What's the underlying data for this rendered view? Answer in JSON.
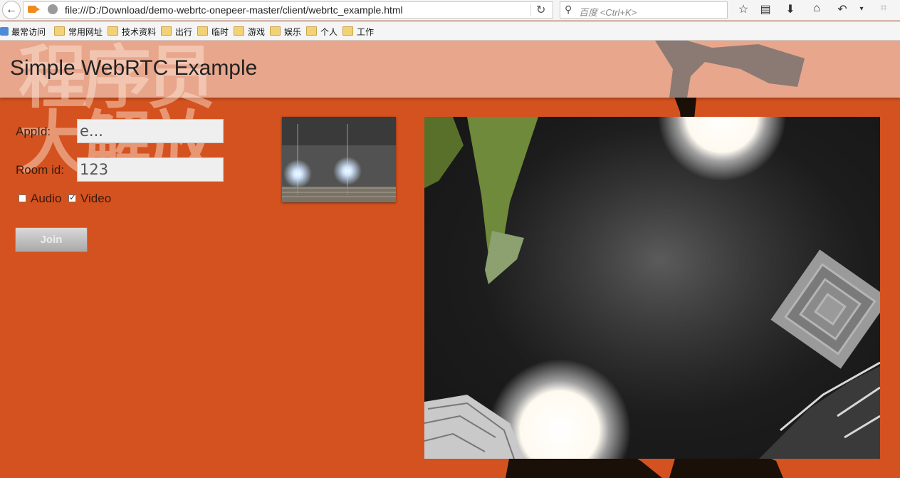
{
  "browser": {
    "url": "file:///D:/Download/demo-webrtc-onepeer-master/client/webrtc_example.html",
    "search_placeholder": "百度 <Ctrl+K>"
  },
  "bookmarks": [
    {
      "label": "最常访问",
      "icon": "bookmark-tool-icon"
    },
    {
      "label": "常用网址",
      "icon": "folder-icon"
    },
    {
      "label": "技术资料",
      "icon": "folder-icon"
    },
    {
      "label": "出行",
      "icon": "folder-icon"
    },
    {
      "label": "临时",
      "icon": "folder-icon"
    },
    {
      "label": "游戏",
      "icon": "folder-icon"
    },
    {
      "label": "娱乐",
      "icon": "folder-icon"
    },
    {
      "label": "个人",
      "icon": "folder-icon"
    },
    {
      "label": "工作",
      "icon": "folder-icon"
    }
  ],
  "page": {
    "title": "Simple WebRTC Example",
    "watermark": "程序员\n大解放",
    "form": {
      "appid_label": "AppId:",
      "appid_value": "e...",
      "roomid_label": "Room id:",
      "roomid_value": "123",
      "audio_label": "Audio",
      "audio_checked": false,
      "video_label": "Video",
      "video_checked": true,
      "join_label": "Join"
    }
  },
  "colors": {
    "page_bg": "#d4521f",
    "header_bg": "#e8a68c",
    "accent_icon": "#f08a1c"
  }
}
